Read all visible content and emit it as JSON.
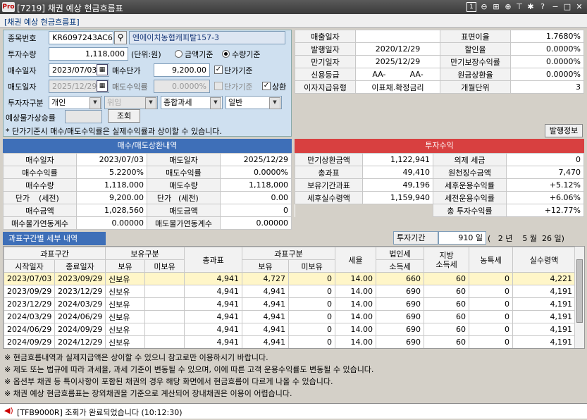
{
  "window": {
    "logo": "Pro",
    "title": "[7219] 채권 예상 현금흐름표",
    "page_no": "1"
  },
  "panel_title": "[채권 예상 현금흐름표]",
  "form": {
    "code_label": "종목번호",
    "code_value": "KR6097243AC6",
    "code_name": "엔에이치농협캐피탈157-3",
    "qty_label": "투자수량",
    "qty_value": "1,118,000",
    "unit_text": "(단위:원)",
    "radio_amount_label": "금액기준",
    "radio_qty_label": "수량기준",
    "buy_date_label": "매수일자",
    "buy_date_value": "2023/07/03",
    "buy_price_label": "매수단가",
    "buy_price_value": "9,200.00",
    "unit_price_label": "단가기준",
    "sell_date_label": "매도일자",
    "sell_date_value": "2025/12/29",
    "sell_yield_label": "매도수익률",
    "sell_yield_value": "0.0000%",
    "unit_price2_label": "단가기준",
    "redeem_label": "상환",
    "investor_label": "투자자구분",
    "investor_value": "개인",
    "entrust_value": "위임",
    "tax_value": "종합과세",
    "general_value": "일반",
    "exp_rate_label": "예상물가상승률",
    "query_button": "조회",
    "note": "* 단가기준시 매수/매도수익률은 실제수익률과 상이할 수 있습니다."
  },
  "bond_info": {
    "rows": [
      {
        "l1": "매출일자",
        "v1": "",
        "l2": "표면이율",
        "v2": "1.7680%"
      },
      {
        "l1": "발행일자",
        "v1": "2020/12/29",
        "l2": "할인율",
        "v2": "0.0000%"
      },
      {
        "l1": "만기일자",
        "v1": "2025/12/29",
        "l2": "만기보장수익률",
        "v2": "0.0000%"
      },
      {
        "l1": "신용등급",
        "v1": "AA-",
        "v1b": "AA-",
        "l2": "원금상환율",
        "v2": "0.0000%"
      },
      {
        "l1": "이자지급유형",
        "v1": "이표채.확정금리",
        "l2": "개월단위",
        "v2": "3"
      }
    ],
    "issue_info_button": "발행정보"
  },
  "trade": {
    "header": "매수/매도상환내역",
    "rows": [
      {
        "l1": "매수일자",
        "v1": "2023/07/03",
        "l2": "매도일자",
        "v2": "2025/12/29"
      },
      {
        "l1": "매수수익률",
        "v1": "5.2200%",
        "l2": "매도수익률",
        "v2": "0.0000%"
      },
      {
        "l1": "매수수량",
        "v1": "1,118,000",
        "l2": "매도수량",
        "v2": "1,118,000"
      },
      {
        "l1": "단가",
        "l1b": "(세전)",
        "v1": "9,200.00",
        "l2": "단가",
        "l2b": "(세전)",
        "v2": "0.00"
      },
      {
        "l1": "매수금액",
        "v1": "1,028,560",
        "l2": "매도금액",
        "v2": "0"
      },
      {
        "l1": "매수물가연동계수",
        "v1": "0.00000",
        "l2": "매도물가연동계수",
        "v2": "0.00000"
      }
    ]
  },
  "returns": {
    "header": "투자수익",
    "rows": [
      {
        "l1": "만기상환금액",
        "v1": "1,122,941",
        "l2": "의제 세금",
        "v2": "0"
      },
      {
        "l1": "총과표",
        "v1": "49,410",
        "l2": "원천징수금액",
        "v2": "7,470"
      },
      {
        "l1": "보유기간과표",
        "v1": "49,196",
        "l2": "세후운용수익률",
        "v2": "+5.12%"
      },
      {
        "l1": "세후실수령액",
        "v1": "1,159,940",
        "l2": "세전운용수익률",
        "v2": "+6.06%"
      },
      {
        "l1": "",
        "v1": "",
        "l2": "총 투자수익률",
        "v2": "+12.77%"
      }
    ]
  },
  "detail": {
    "tab": "과표구간별 세부 내역",
    "period_label": "투자기간",
    "period_days": "910 일",
    "period_text": "(   2 년    5 월  26 일)",
    "headers": {
      "range": "과표구간",
      "hold_type": "보유구분",
      "total_base": "총과표",
      "base_type": "과표구분",
      "tax_rate": "세율",
      "corp_tax": "법인세",
      "income_tax": "소득세",
      "local_tax": "지방\n소득세",
      "agri_tax": "농특세",
      "actual": "실수령액",
      "start": "시작일자",
      "end": "종료일자",
      "own": "보유",
      "not_own": "미보유",
      "own2": "보유",
      "not_own2": "미보유"
    },
    "rows": [
      [
        "2023/07/03",
        "2023/09/29",
        "신보유",
        "",
        "4,941",
        "4,727",
        "0",
        "14.00",
        "660",
        "60",
        "0",
        "4,221"
      ],
      [
        "2023/09/29",
        "2023/12/29",
        "신보유",
        "",
        "4,941",
        "4,941",
        "0",
        "14.00",
        "690",
        "60",
        "0",
        "4,191"
      ],
      [
        "2023/12/29",
        "2024/03/29",
        "신보유",
        "",
        "4,941",
        "4,941",
        "0",
        "14.00",
        "690",
        "60",
        "0",
        "4,191"
      ],
      [
        "2024/03/29",
        "2024/06/29",
        "신보유",
        "",
        "4,941",
        "4,941",
        "0",
        "14.00",
        "690",
        "60",
        "0",
        "4,191"
      ],
      [
        "2024/06/29",
        "2024/09/29",
        "신보유",
        "",
        "4,941",
        "4,941",
        "0",
        "14.00",
        "690",
        "60",
        "0",
        "4,191"
      ],
      [
        "2024/09/29",
        "2024/12/29",
        "신보유",
        "",
        "4,941",
        "4,941",
        "0",
        "14.00",
        "690",
        "60",
        "0",
        "4,191"
      ]
    ]
  },
  "notes": [
    "※ 현금흐름내역과 실제지급액은 상이할 수 있으니 참고로만 이용하시기 바랍니다.",
    "※ 제도 또는 법규에 따라 과세율, 과세 기준이 변동될 수 있으며, 이에 따른 고객 운용수익률도 변동될 수 있습니다.",
    "※ 옵션부 채권 등 특이사항이 포함된 채권의 경우 해당 화면에서 현금흐름이 다르게 나올 수 있습니다.",
    "※ 채권 예상 현금흐름표는 장외채권을 기준으로 계산되어 장내채권은 이용이 어렵습니다."
  ],
  "status": "[TFB9000R] 조회가 완료되었습니다 (10:12:30)",
  "colors": {
    "blue_header": "#3e6fb8",
    "red_header": "#d84040",
    "selected_row": "#fff6c8"
  }
}
